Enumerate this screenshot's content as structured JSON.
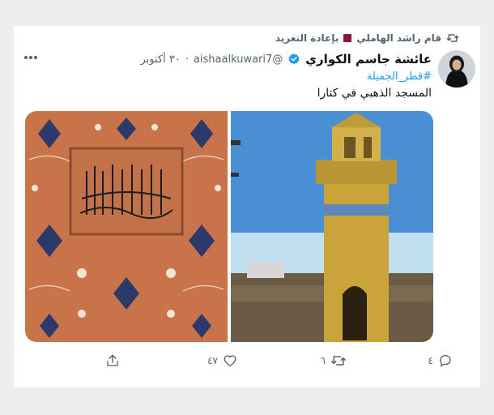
{
  "retweet": {
    "label": "بإعادة التغريد",
    "by": "قام راشد الهاملي"
  },
  "tweet": {
    "name": "عائشة جاسم الكواري",
    "handle": "@aishaalkuwari7",
    "dot": "·",
    "date": "٣٠ أكتوبر",
    "hashtag": "#قطر_الجميلة",
    "text": "المسجد الذهبي في كتارا"
  },
  "media": {
    "left_image": "islamic-tile-calligraphy",
    "right_image": "golden-minaret"
  },
  "actions": {
    "reply_count": "٤",
    "retweet_count": "٦",
    "like_count": "٤٧"
  },
  "colors": {
    "accent": "#1d9bf0",
    "verified": "#1d9bf0",
    "muted": "#536471",
    "qatar_maroon": "#8a1538"
  }
}
